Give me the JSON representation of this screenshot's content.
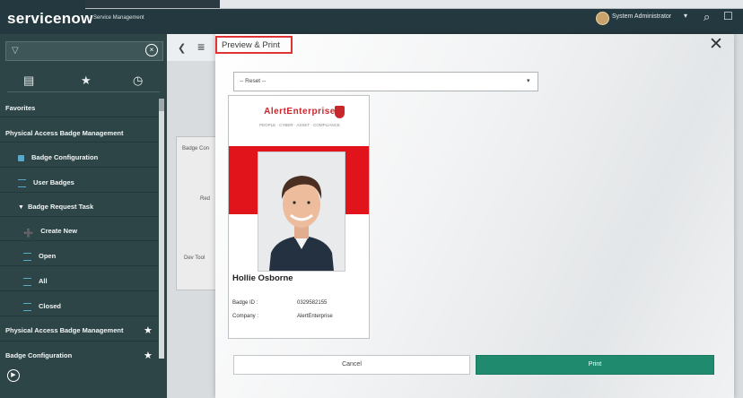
{
  "header": {
    "logo": "servicenow",
    "subtitle": "Service Management",
    "user": "System Administrator",
    "caret": "▾",
    "search_icon": "search-icon",
    "chat_icon": "chat-icon"
  },
  "nav": {
    "filter_placeholder": "",
    "tabs": [
      "all-apps-icon",
      "favorites-star-icon",
      "history-clock-icon"
    ],
    "items": [
      {
        "label": "Favorites",
        "kind": "header"
      },
      {
        "label": "Physical Access Badge Management",
        "kind": "section"
      },
      {
        "label": "Badge Configuration",
        "kind": "module"
      },
      {
        "label": "User Badges",
        "kind": "module"
      },
      {
        "label": "Badge Request Task",
        "kind": "folder"
      },
      {
        "label": "Create New",
        "kind": "module"
      },
      {
        "label": "Open",
        "kind": "module"
      },
      {
        "label": "All",
        "kind": "module"
      },
      {
        "label": "Closed",
        "kind": "module"
      },
      {
        "label": "Physical Access Badge Management",
        "kind": "favorite"
      },
      {
        "label": "Badge Configuration",
        "kind": "favorite"
      }
    ]
  },
  "background_page": {
    "label1": "Badge Con",
    "label2": "Red",
    "label3": "Dev Tool"
  },
  "modal": {
    "title": "Preview & Print",
    "select_value": "-- Reset --",
    "badge": {
      "brand": "AlertEnterprise",
      "tagline": "PEOPLE · CYBER · ASSET · COMPLIANCE",
      "holder_name": "Hollie Osborne",
      "badge_id_label": "Badge ID :",
      "badge_id_value": "0329582155",
      "company_label": "Company :",
      "company_value": "AlertEnterprise"
    },
    "cancel_label": "Cancel",
    "print_label": "Print"
  },
  "colors": {
    "header_bg": "#24393f",
    "nav_bg": "#2e4547",
    "accent_red": "#e0141a",
    "print_green": "#1f8a6e"
  }
}
